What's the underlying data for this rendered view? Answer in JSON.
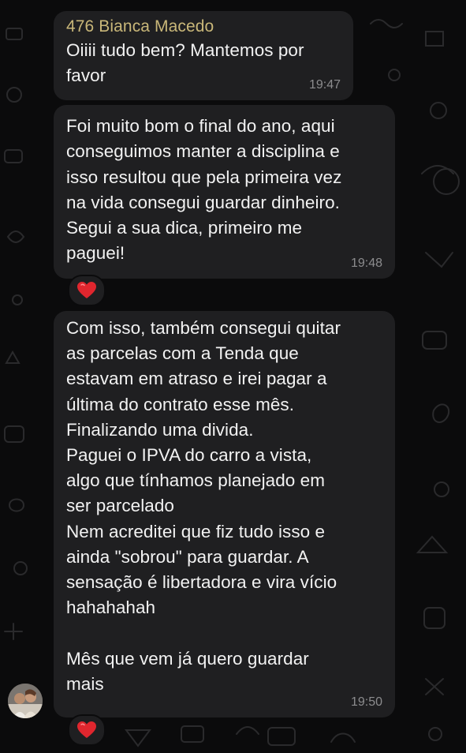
{
  "messages": [
    {
      "sender": "476 Bianca Macedo",
      "text": "Oiiii tudo bem? Mantemos por\nfavor",
      "time": "19:47"
    },
    {
      "text": "Foi muito bom o final do ano, aqui\nconseguimos manter a disciplina e\nisso resultou que pela primeira vez\nna vida consegui guardar dinheiro.\nSegui a sua dica, primeiro me\npaguei!",
      "time": "19:48",
      "reaction": "❤️"
    },
    {
      "text": "Com isso, também consegui quitar\nas parcelas com a Tenda que\nestavam em atraso e irei pagar a\núltima do contrato esse mês.\nFinalizando uma divida.\nPaguei o IPVA do carro a vista,\nalgo que tínhamos planejado em\nser parcelado\nNem acreditei que fiz tudo isso e\nainda \"sobrou\" para guardar. A\nsensação é libertadora e vira vício\nhahahahah\n\nMês que vem já quero guardar\nmais",
      "time": "19:50",
      "reaction": "❤️"
    }
  ],
  "colors": {
    "background": "#0b0b0c",
    "bubble": "#1f1f21",
    "sender_name": "#c9b779",
    "message_text": "#f2f2f2",
    "timestamp": "#8c8c8e",
    "reaction_heart": "#e0262e"
  },
  "icons": {
    "reaction": "heart-icon",
    "avatar": "contact-avatar"
  }
}
